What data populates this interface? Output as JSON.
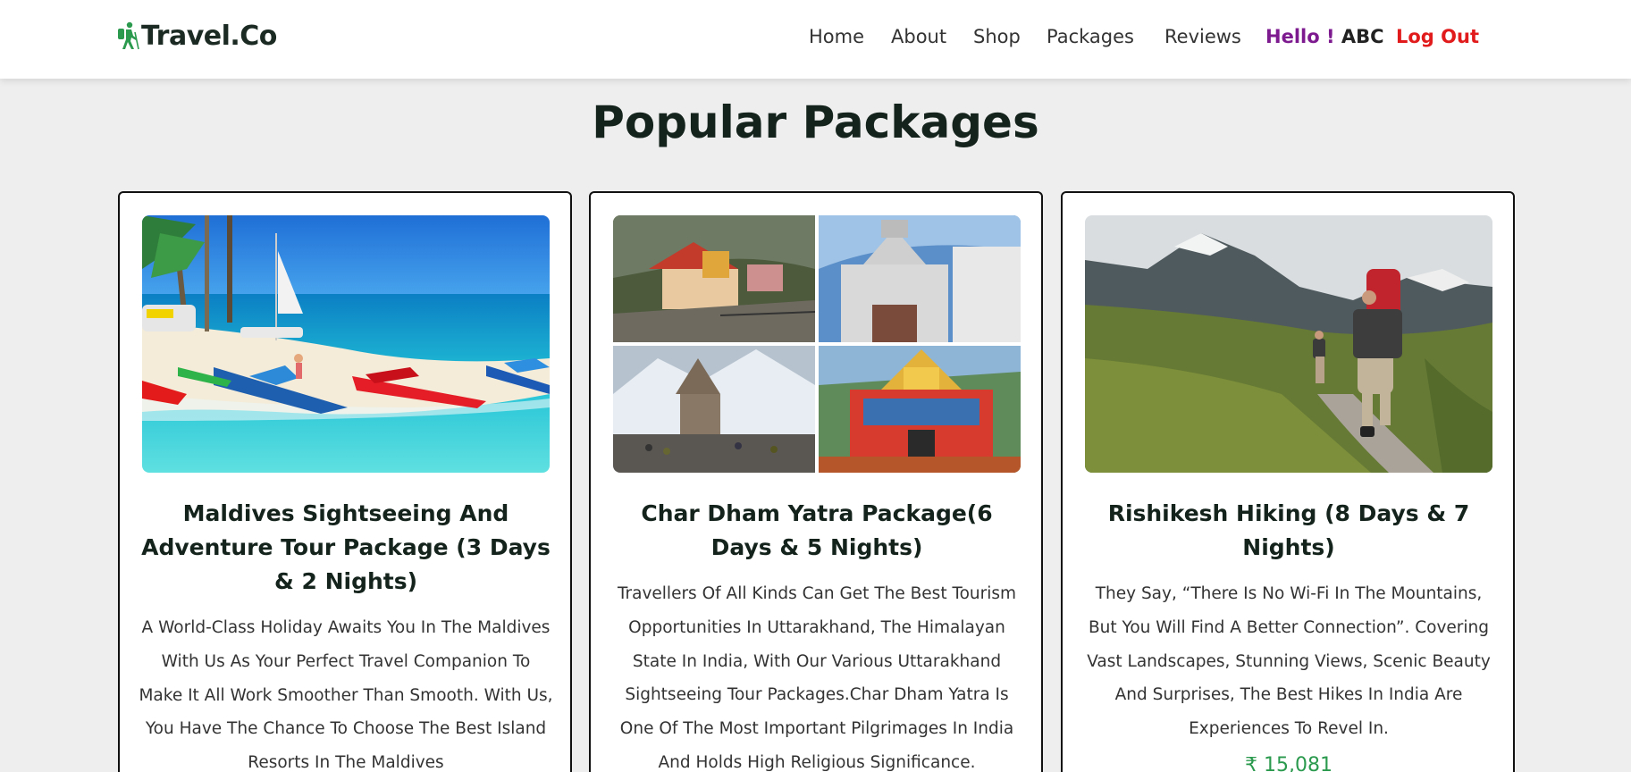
{
  "brand": {
    "name": "Travel.Co",
    "accent": "#2b9a4e"
  },
  "nav": {
    "items": [
      "Home",
      "About",
      "Shop",
      "Packages",
      "Reviews"
    ],
    "greeting": "Hello !",
    "user": "ABC",
    "logout": "Log Out"
  },
  "page_title": "Popular Packages",
  "packages": [
    {
      "title": "Maldives Sightseeing And Adventure Tour Package (3 Days & 2 Nights)",
      "description": "A World-Class Holiday Awaits You In The Maldives With Us As Your Perfect Travel Companion To Make It All Work Smoother Than Smooth. With Us, You Have The Chance To Choose The Best Island Resorts In The Maldives",
      "image": "beach-boats-image"
    },
    {
      "title": "Char Dham Yatra Package(6 Days & 5 Nights)",
      "description": "Travellers Of All Kinds Can Get The Best Tourism Opportunities In Uttarakhand, The Himalayan State In India, With Our Various Uttarakhand Sightseeing Tour Packages.Char Dham Yatra Is One Of The Most Important Pilgrimages In India And Holds High Religious Significance.",
      "image": "temples-collage-image"
    },
    {
      "title": "Rishikesh Hiking (8 Days & 7 Nights)",
      "description": "They Say, “There Is No Wi-Fi In The Mountains, But You Will Find A Better Connection”. Covering Vast Landscapes, Stunning Views, Scenic Beauty And Surprises, The Best Hikes In India Are Experiences To Revel In.",
      "price": "₹ 15,081",
      "image": "mountain-hikers-image"
    }
  ]
}
